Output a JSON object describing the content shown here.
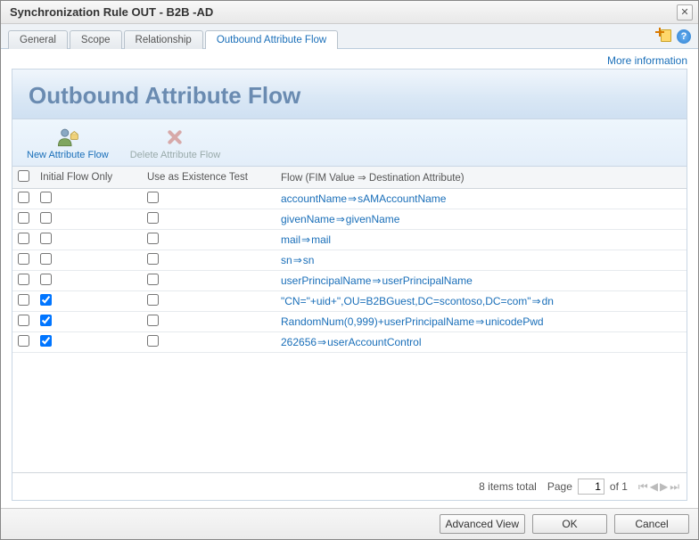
{
  "window": {
    "title": "Synchronization Rule OUT - B2B -AD"
  },
  "tabs": [
    {
      "label": "General"
    },
    {
      "label": "Scope"
    },
    {
      "label": "Relationship"
    },
    {
      "label": "Outbound Attribute Flow"
    }
  ],
  "active_tab_index": 3,
  "link_more_info": "More information",
  "panel": {
    "title": "Outbound Attribute Flow",
    "actions": {
      "new_label": "New Attribute Flow",
      "delete_label": "Delete Attribute Flow"
    },
    "columns": {
      "initial_flow": "Initial Flow Only",
      "use_existence": "Use as Existence Test",
      "flow": "Flow (FIM Value ⇒ Destination Attribute)"
    },
    "rows": [
      {
        "initial": false,
        "exist": false,
        "src": "accountName",
        "dst": "sAMAccountName"
      },
      {
        "initial": false,
        "exist": false,
        "src": "givenName",
        "dst": "givenName"
      },
      {
        "initial": false,
        "exist": false,
        "src": "mail",
        "dst": "mail"
      },
      {
        "initial": false,
        "exist": false,
        "src": "sn",
        "dst": "sn"
      },
      {
        "initial": false,
        "exist": false,
        "src": "userPrincipalName",
        "dst": "userPrincipalName"
      },
      {
        "initial": true,
        "exist": false,
        "src": "\"CN=\"+uid+\",OU=B2BGuest,DC=scontoso,DC=com\"",
        "dst": "dn"
      },
      {
        "initial": true,
        "exist": false,
        "src": "RandomNum(0,999)+userPrincipalName",
        "dst": "unicodePwd"
      },
      {
        "initial": true,
        "exist": false,
        "src": "262656",
        "dst": "userAccountControl"
      }
    ]
  },
  "pager": {
    "items_total_label": "8 items total",
    "page_label": "Page",
    "page_current": "1",
    "of_label": "of 1"
  },
  "buttons": {
    "advanced": "Advanced View",
    "ok": "OK",
    "cancel": "Cancel"
  }
}
